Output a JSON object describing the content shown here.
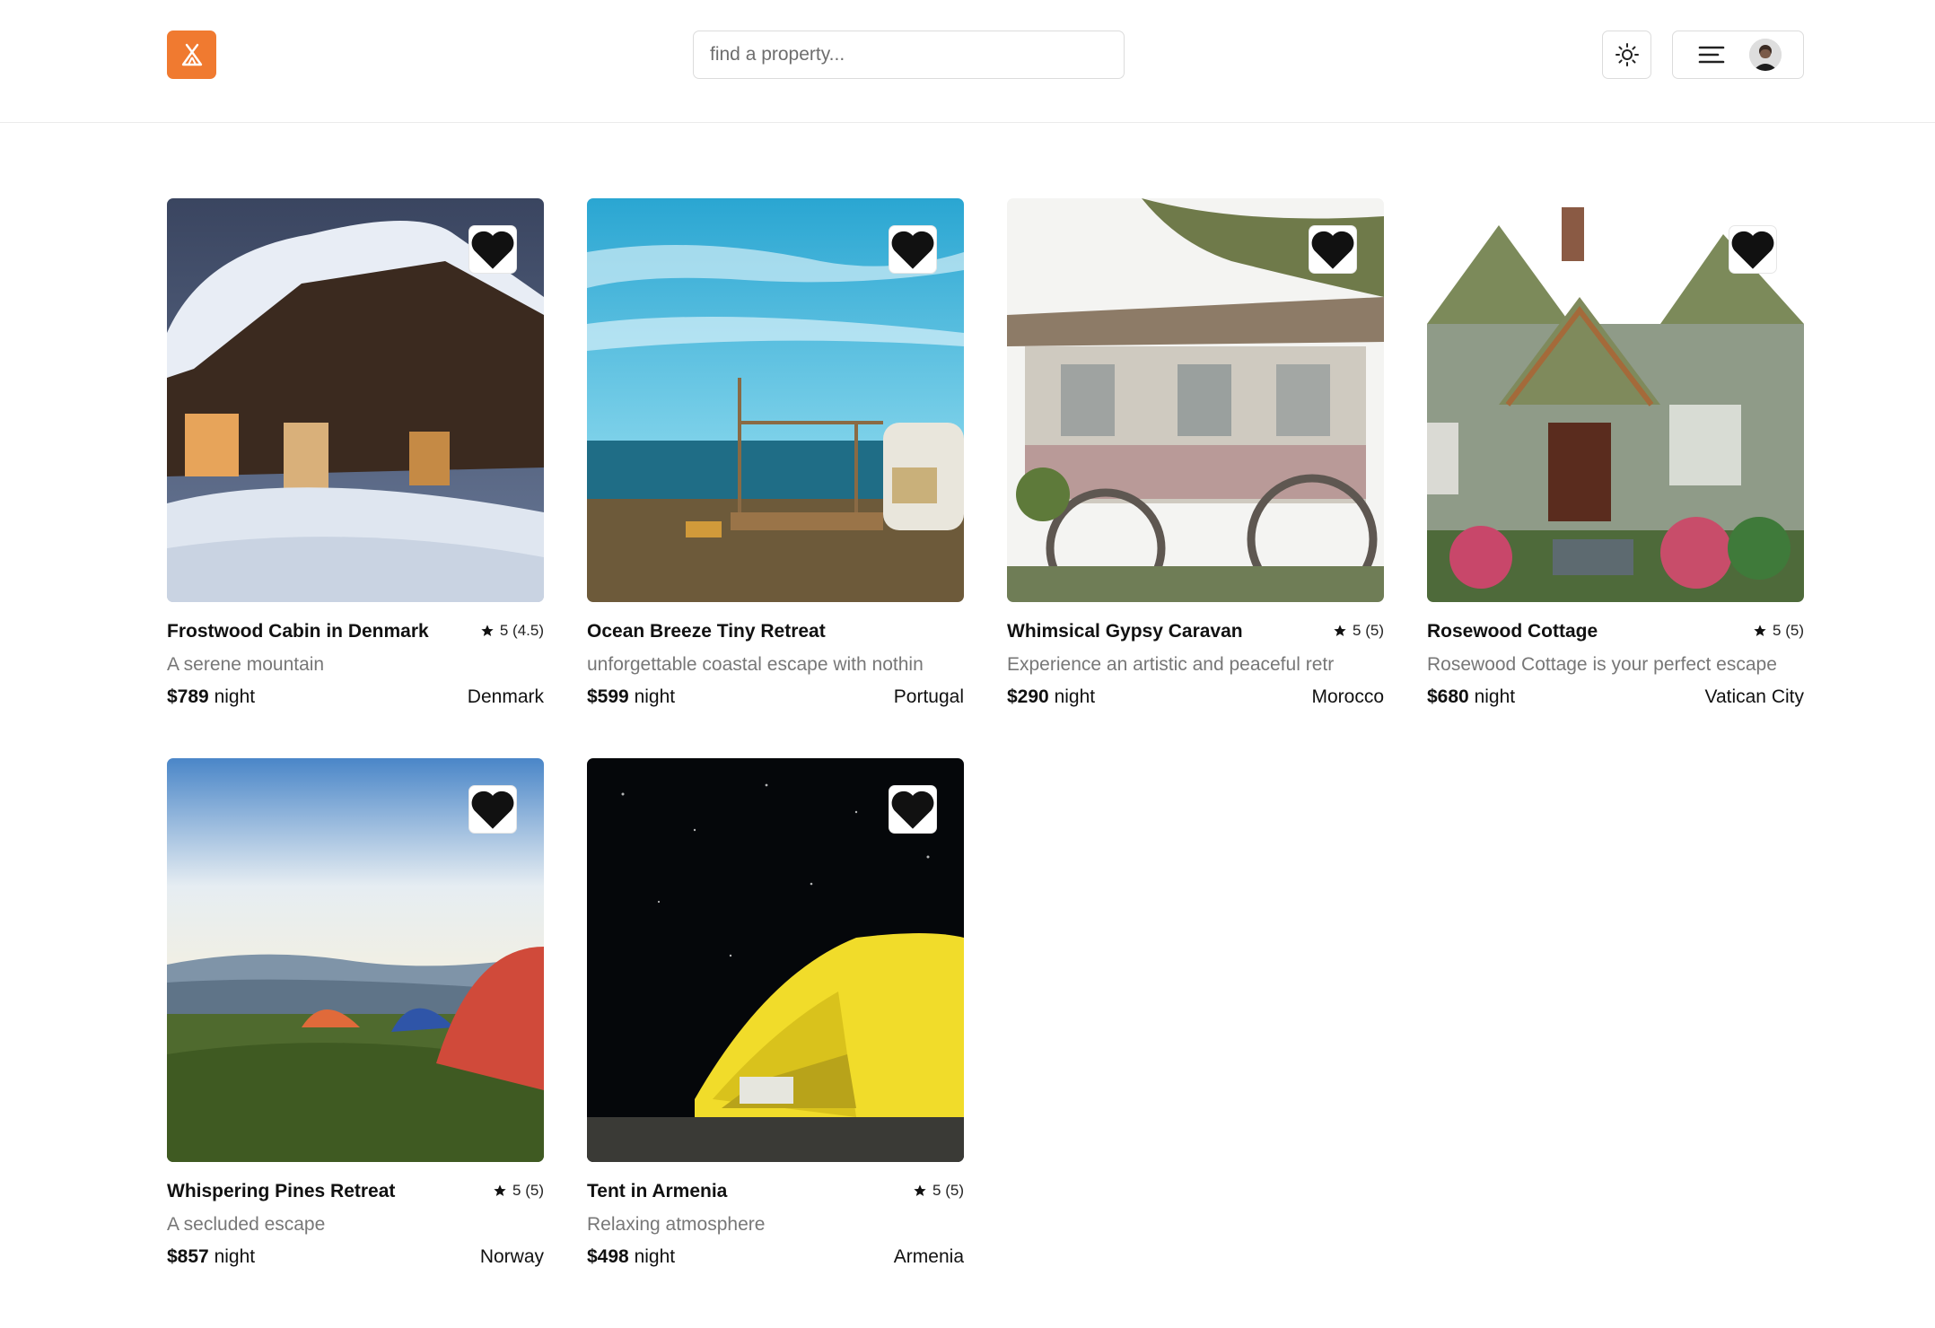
{
  "header": {
    "logo_icon": "tent-icon",
    "brand_color": "#f07a30",
    "search_placeholder": "find a property...",
    "theme_icon": "sun-icon",
    "menu_icon": "menu-lines-icon"
  },
  "price_unit": "night",
  "listings": [
    {
      "title": "Frostwood Cabin in Denmark",
      "rating": "5 (4.5)",
      "description": "A serene mountain",
      "price": "$789",
      "country": "Denmark"
    },
    {
      "title": "Ocean Breeze Tiny Retreat",
      "rating": "",
      "description": "unforgettable coastal escape with nothin",
      "price": "$599",
      "country": "Portugal"
    },
    {
      "title": "Whimsical Gypsy Caravan",
      "rating": "5 (5)",
      "description": "Experience an artistic and peaceful retr",
      "price": "$290",
      "country": "Morocco"
    },
    {
      "title": "Rosewood Cottage",
      "rating": "5 (5)",
      "description": "Rosewood Cottage is your perfect escape",
      "price": "$680",
      "country": "Vatican City"
    },
    {
      "title": "Whispering Pines Retreat",
      "rating": "5 (5)",
      "description": "A secluded escape",
      "price": "$857",
      "country": "Norway"
    },
    {
      "title": "Tent in Armenia",
      "rating": "5 (5)",
      "description": "Relaxing atmosphere",
      "price": "$498",
      "country": "Armenia"
    }
  ]
}
